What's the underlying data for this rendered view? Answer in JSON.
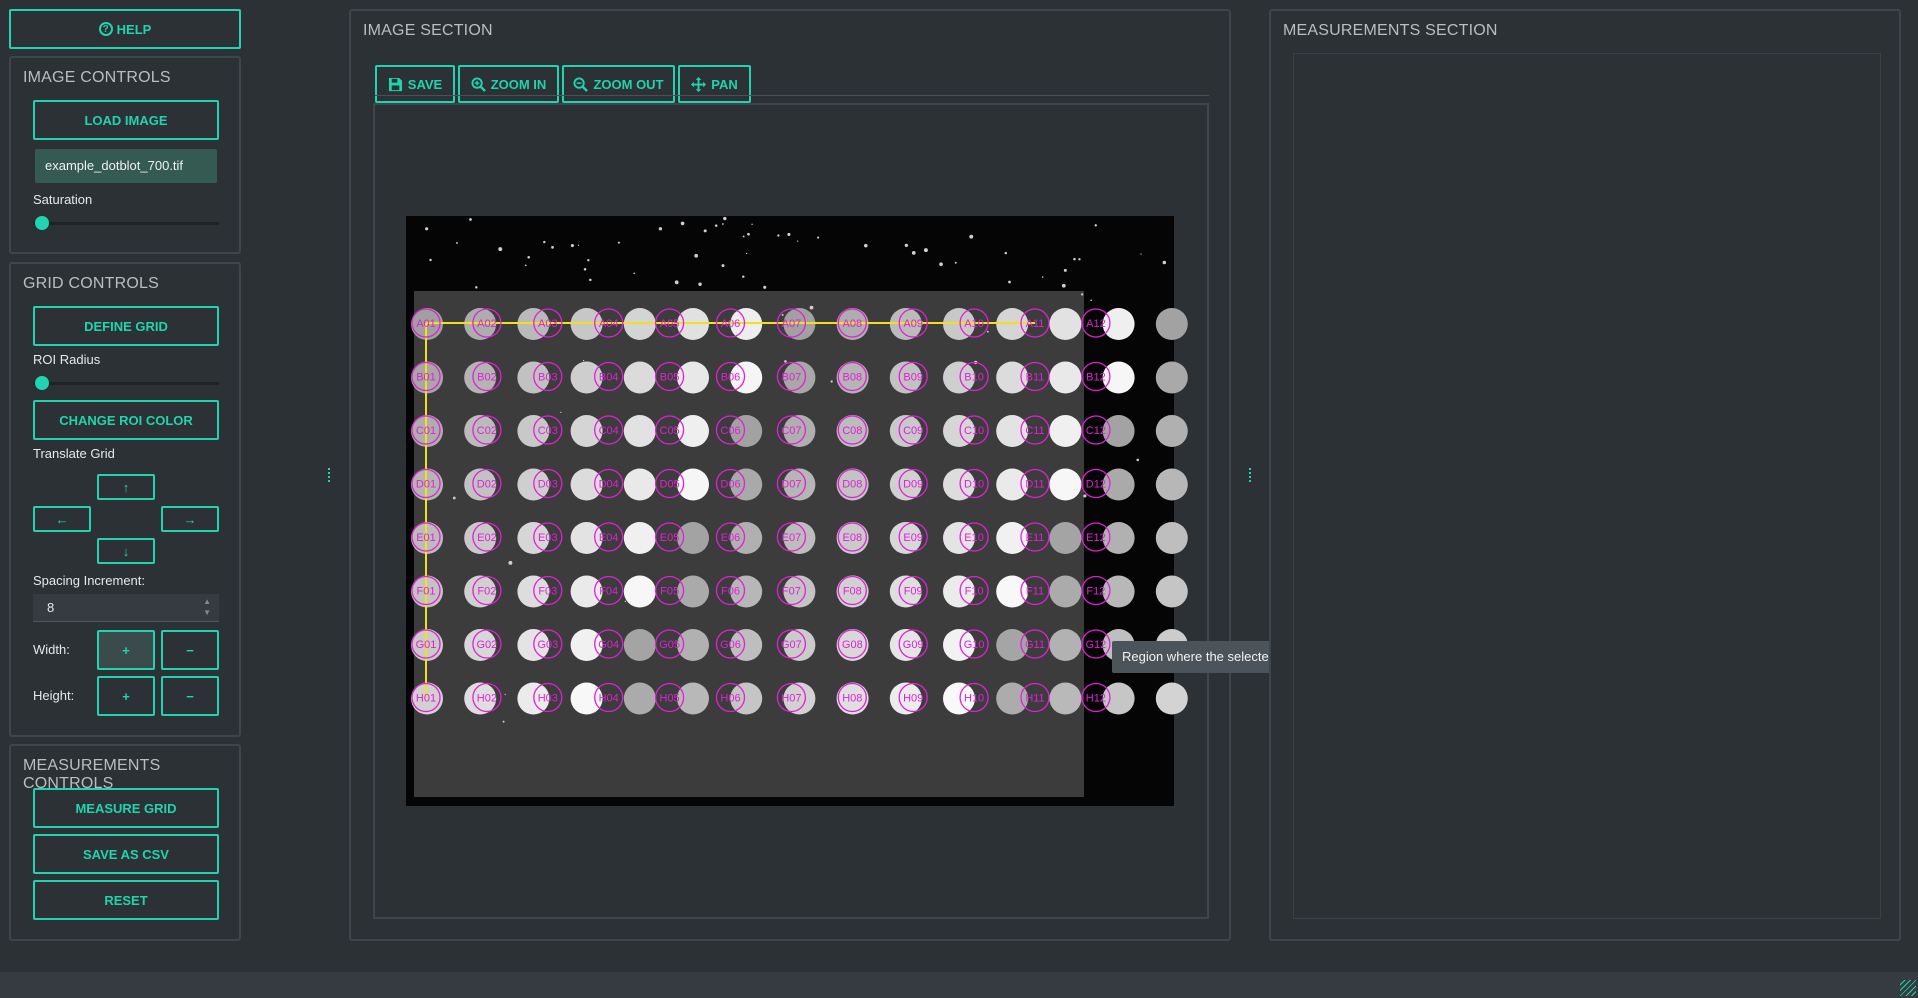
{
  "help_label": "HELP",
  "image_controls": {
    "title": "IMAGE CONTROLS",
    "load_label": "LOAD IMAGE",
    "filename": "example_dotblot_700.tif",
    "saturation_label": "Saturation",
    "saturation_value": 0.05
  },
  "grid_controls": {
    "title": "GRID CONTROLS",
    "define_label": "DEFINE GRID",
    "roi_radius_label": "ROI Radius",
    "roi_radius_value": 0.05,
    "change_color_label": "CHANGE ROI COLOR",
    "translate_label": "Translate Grid",
    "up": "↑",
    "left": "←",
    "right": "→",
    "down": "↓",
    "spacing_label": "Spacing Increment:",
    "spacing_value": "8",
    "width_label": "Width:",
    "height_label": "Height:",
    "plus": "+",
    "minus": "−"
  },
  "measurements_controls": {
    "title": "MEASUREMENTS CONTROLS",
    "measure_label": "MEASURE GRID",
    "csv_label": "SAVE AS CSV",
    "reset_label": "RESET"
  },
  "image_section": {
    "title": "IMAGE SECTION",
    "toolbar": {
      "save": "SAVE",
      "zoom_in": "ZOOM IN",
      "zoom_out": "ZOOM OUT",
      "pan": "PAN"
    },
    "tooltip": "Region where the selected image is displayed.",
    "grid_rows": [
      "A",
      "B",
      "C",
      "D",
      "E",
      "F",
      "G",
      "H"
    ],
    "grid_cols": 12,
    "roi_color": "#e020d8",
    "grid_line_color": "#f0e020"
  },
  "measurements_section": {
    "title": "MEASUREMENTS SECTION"
  },
  "colors": {
    "accent": "#1fd4ae",
    "background": "#2c3135"
  }
}
